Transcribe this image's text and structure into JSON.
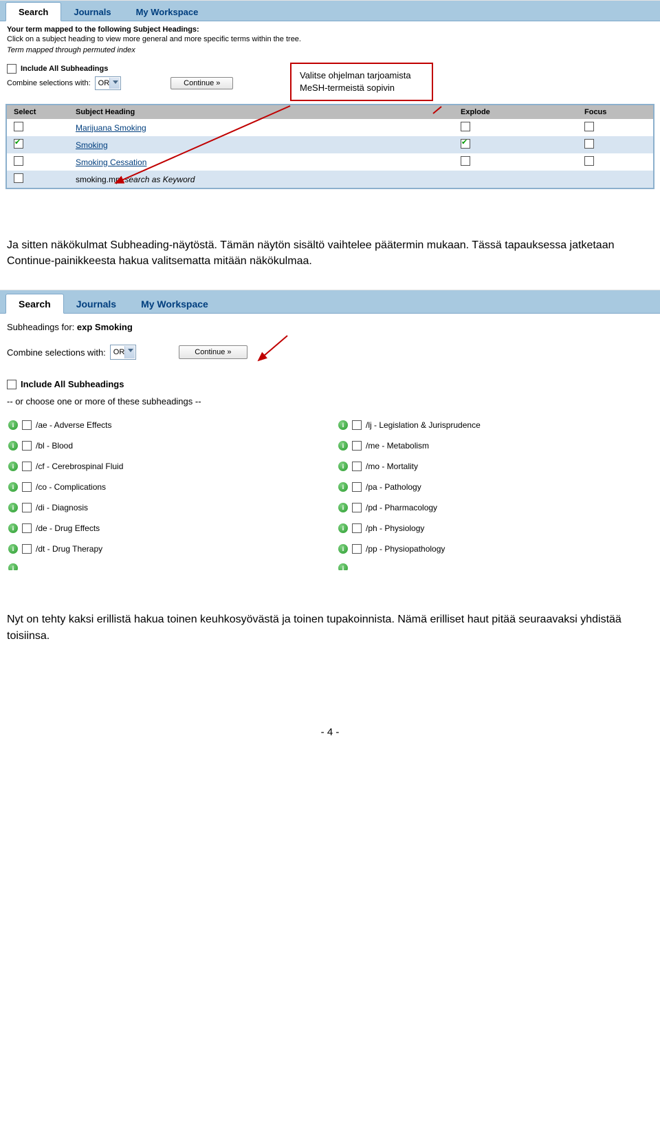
{
  "screenshot1": {
    "tabs": {
      "search": "Search",
      "journals": "Journals",
      "workspace": "My Workspace"
    },
    "mapped_line1": "Your term mapped to the following Subject Headings:",
    "mapped_line2": "Click on a subject heading to view more general and more specific terms within the tree.",
    "mapped_line3": "Term mapped through permuted index",
    "include_all": "Include All Subheadings",
    "combine_label": "Combine selections with:",
    "combine_value": "OR",
    "continue_label": "Continue »",
    "callout": "Valitse ohjelman tarjoamista MeSH-termeistä sopivin",
    "th_select": "Select",
    "th_subject": "Subject Heading",
    "th_explode": "Explode",
    "th_focus": "Focus",
    "rows": [
      {
        "label": "Marijuana Smoking",
        "link": true,
        "sel": false,
        "exp": false,
        "foc": false
      },
      {
        "label": "Smoking",
        "link": true,
        "sel": true,
        "exp": true,
        "foc": false
      },
      {
        "label": "Smoking Cessation",
        "link": true,
        "sel": false,
        "exp": false,
        "foc": false
      }
    ],
    "keyword_row": {
      "label": "smoking.mp.",
      "note": "search as Keyword"
    }
  },
  "para1": "Ja sitten näkökulmat Subheading-näytöstä. Tämän näytön sisältö vaihtelee päätermin mukaan. Tässä tapauksessa jatketaan Continue-painikkeesta hakua valitsematta mitään näkökulmaa.",
  "screenshot2": {
    "tabs": {
      "search": "Search",
      "journals": "Journals",
      "workspace": "My Workspace"
    },
    "subheadings_for": "Subheadings for: ",
    "subheadings_term": "exp Smoking",
    "combine_label": "Combine selections with:",
    "combine_value": "OR",
    "continue_label": "Continue »",
    "include_all": "Include All Subheadings",
    "choose_line": "-- or choose one or more of these subheadings --",
    "left": [
      "/ae - Adverse Effects",
      "/bl - Blood",
      "/cf - Cerebrospinal Fluid",
      "/co - Complications",
      "/di - Diagnosis",
      "/de - Drug Effects",
      "/dt - Drug Therapy"
    ],
    "right": [
      "/lj - Legislation & Jurisprudence",
      "/me - Metabolism",
      "/mo - Mortality",
      "/pa - Pathology",
      "/pd - Pharmacology",
      "/ph - Physiology",
      "/pp - Physiopathology"
    ]
  },
  "para2": "Nyt on tehty kaksi erillistä hakua toinen keuhkosyövästä ja toinen tupakoinnista. Nämä erilliset haut pitää seuraavaksi yhdistää toisiinsa.",
  "footer": "- 4 -"
}
